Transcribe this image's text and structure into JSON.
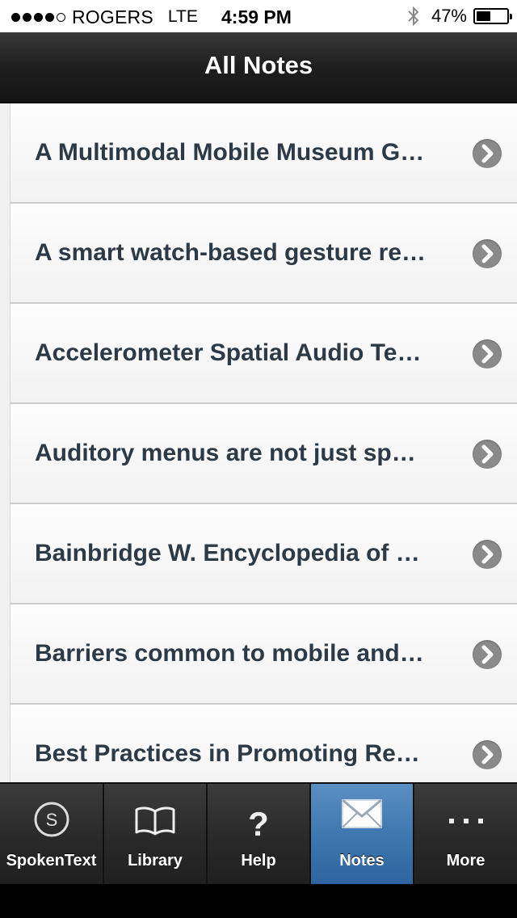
{
  "status_bar": {
    "carrier": "ROGERS",
    "network": "LTE",
    "time": "4:59 PM",
    "battery_percent": "47%",
    "battery_level": 0.47,
    "signal_strength": 4,
    "signal_max": 5
  },
  "nav": {
    "title": "All Notes"
  },
  "notes": [
    {
      "title": "A Multimodal Mobile Museum G…"
    },
    {
      "title": "A smart watch-based gesture re…"
    },
    {
      "title": "Accelerometer Spatial Audio Te…"
    },
    {
      "title": "Auditory menus are not just sp…"
    },
    {
      "title": "Bainbridge W. Encyclopedia of …"
    },
    {
      "title": "Barriers common to mobile and…"
    },
    {
      "title": "Best Practices in Promoting Re…"
    }
  ],
  "tabs": [
    {
      "label": "SpokenText",
      "icon": "spokentext-icon"
    },
    {
      "label": "Library",
      "icon": "book-icon"
    },
    {
      "label": "Help",
      "icon": "question-mark-icon"
    },
    {
      "label": "Notes",
      "icon": "envelope-icon",
      "active": true
    },
    {
      "label": "More",
      "icon": "more-dots-icon"
    }
  ],
  "colors": {
    "note_title": "#2b3a46",
    "active_tab": "#3f78b0",
    "chevron": "#8a8a8a"
  }
}
